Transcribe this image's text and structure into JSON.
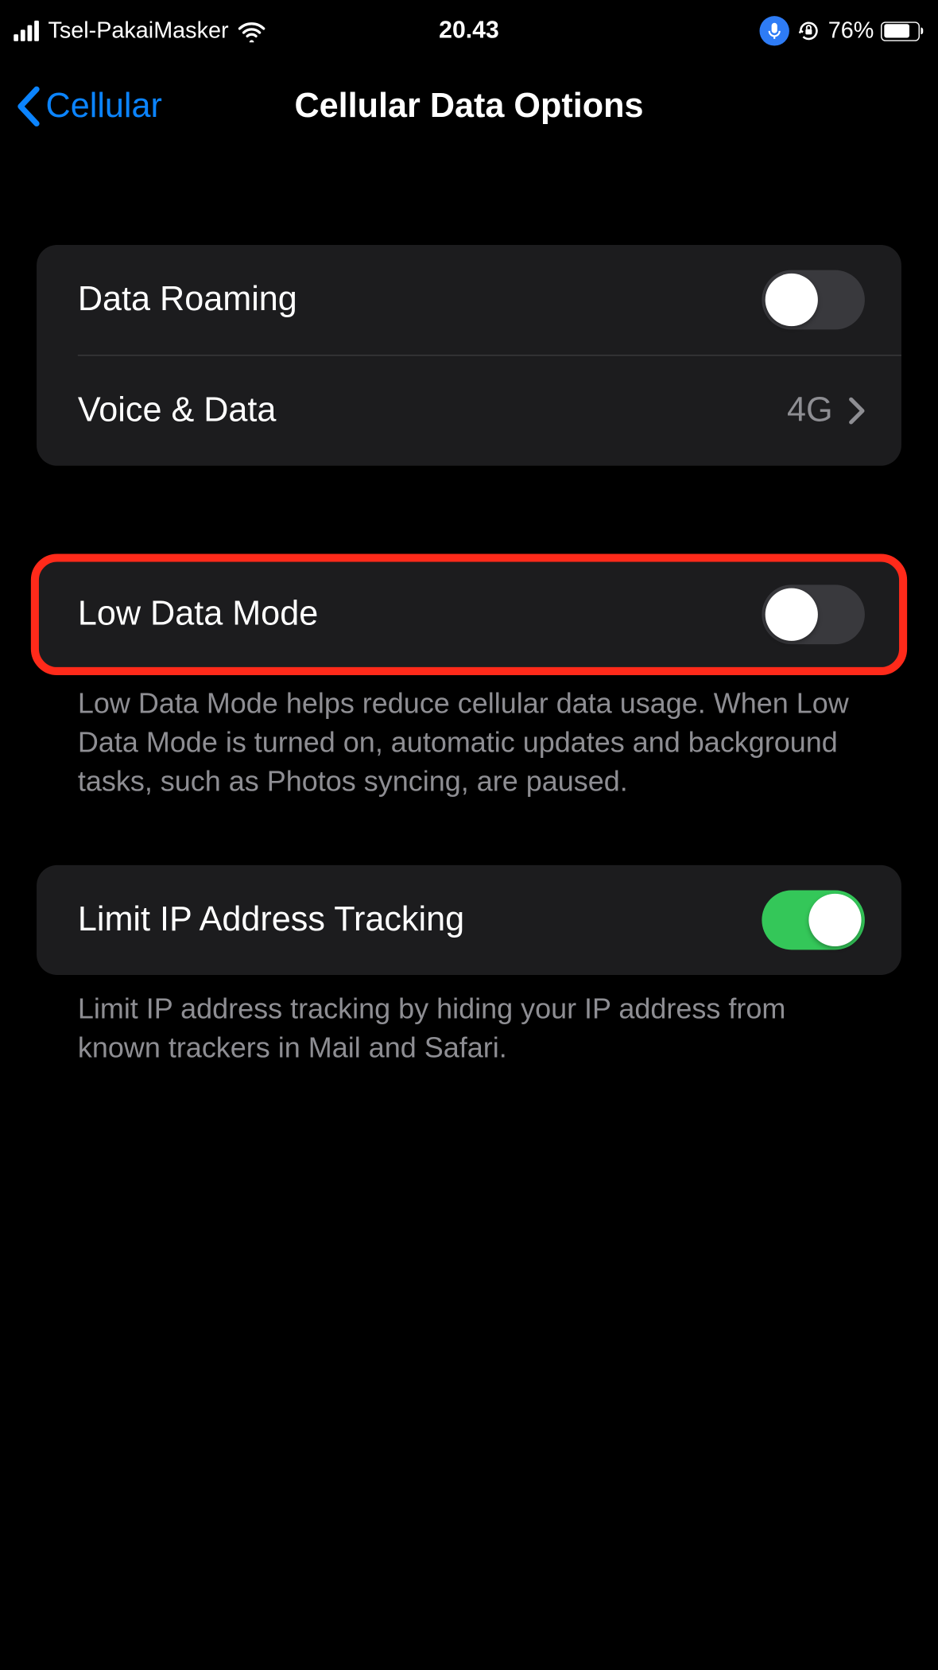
{
  "status_bar": {
    "carrier": "Tsel-PakaiMasker",
    "time": "20.43",
    "battery_percent": "76%"
  },
  "nav": {
    "back_label": "Cellular",
    "title": "Cellular Data Options"
  },
  "group1": {
    "row_roaming_label": "Data Roaming",
    "row_voice_label": "Voice & Data",
    "row_voice_value": "4G"
  },
  "group2": {
    "row_lowdata_label": "Low Data Mode",
    "footer": "Low Data Mode helps reduce cellular data usage. When Low Data Mode is turned on, automatic updates and background tasks, such as Photos syncing, are paused."
  },
  "group3": {
    "row_limitip_label": "Limit IP Address Tracking",
    "footer": "Limit IP address tracking by hiding your IP address from known trackers in Mail and Safari."
  },
  "toggles": {
    "data_roaming": false,
    "low_data_mode": false,
    "limit_ip_tracking": true
  }
}
